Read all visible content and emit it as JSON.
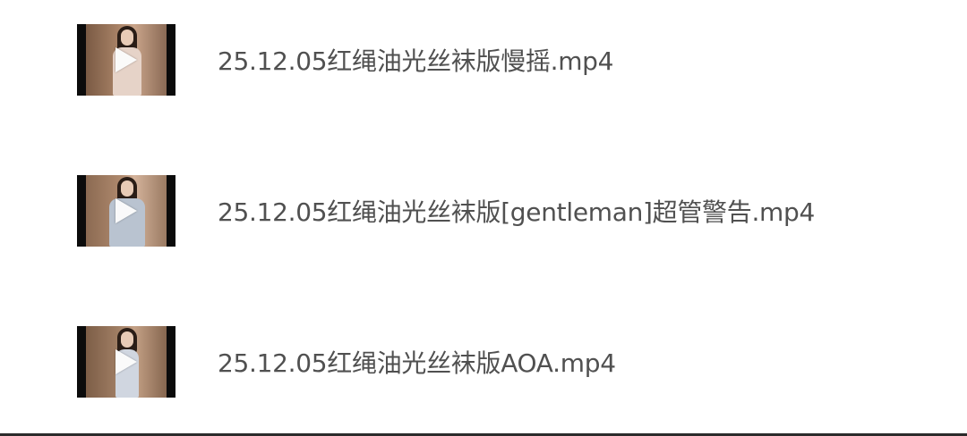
{
  "files": [
    {
      "name": "25.12.05红绳油光丝袜版慢摇.mp4",
      "thumbnail_icon": "play-icon"
    },
    {
      "name": "25.12.05红绳油光丝袜版[gentleman]超管警告.mp4",
      "thumbnail_icon": "play-icon"
    },
    {
      "name": "25.12.05红绳油光丝袜版AOA.mp4",
      "thumbnail_icon": "play-icon"
    }
  ]
}
